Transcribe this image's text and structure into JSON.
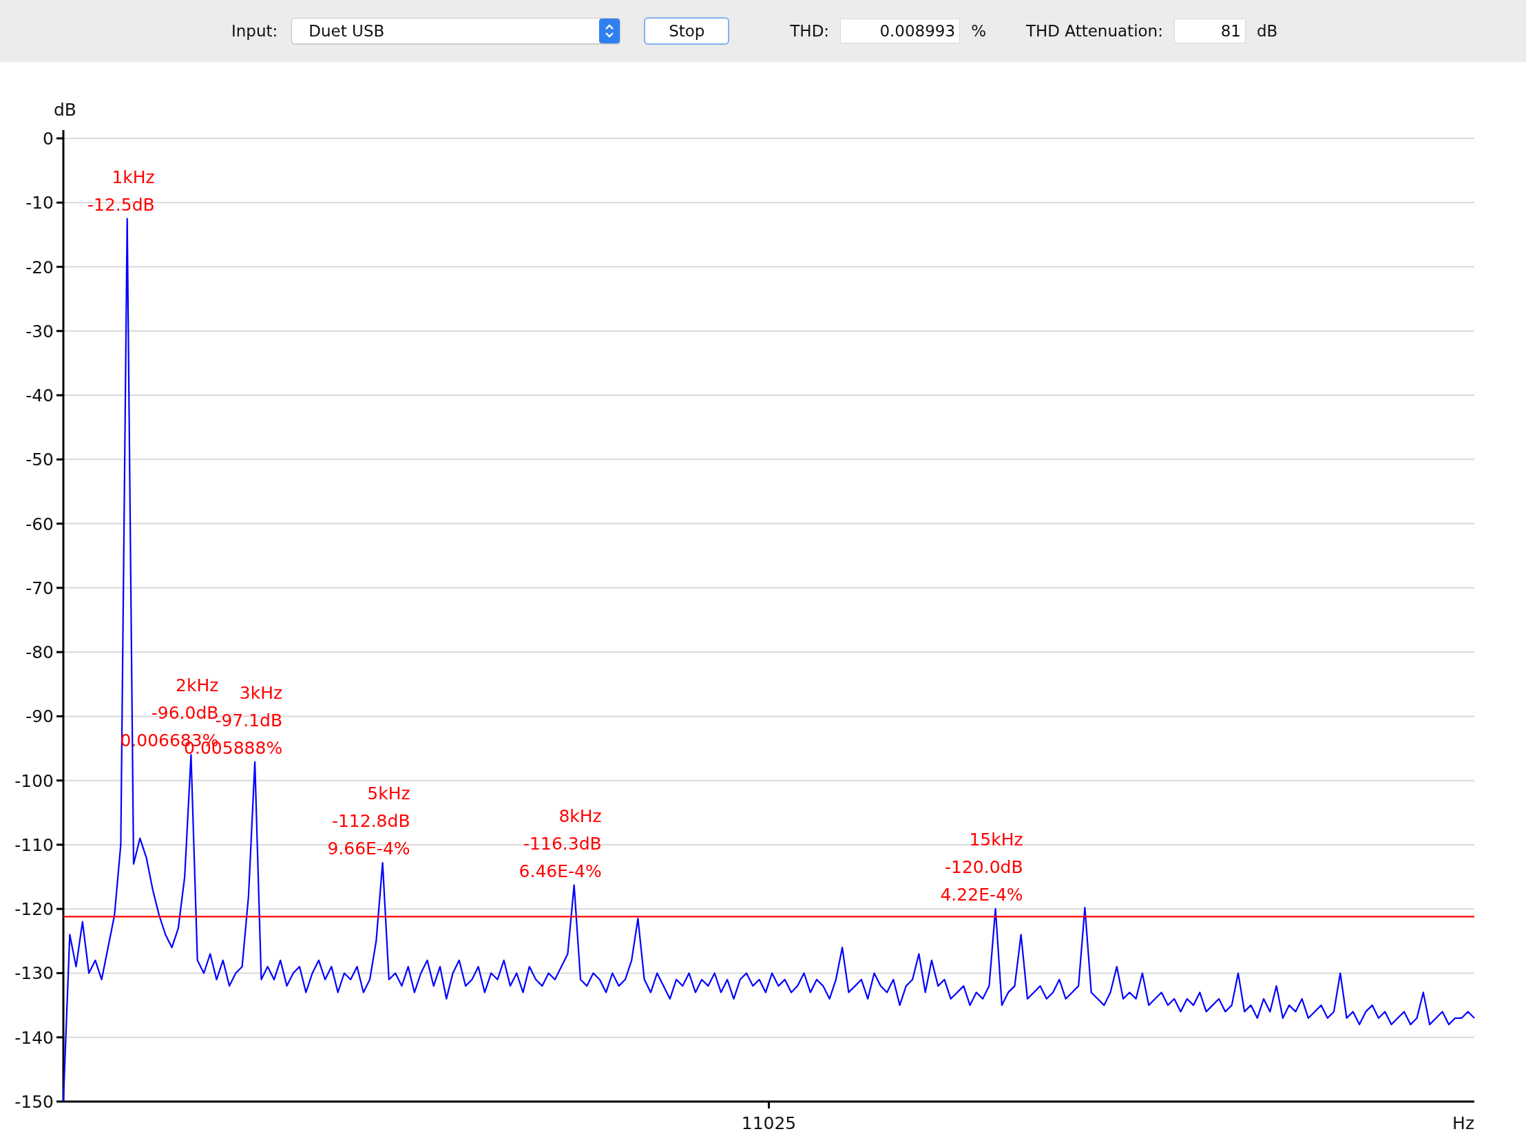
{
  "toolbar": {
    "input_label": "Input:",
    "input_dropdown": {
      "value": "Duet USB"
    },
    "stop_button": "Stop",
    "thd_label": "THD:",
    "thd_field": {
      "value": "0.008993"
    },
    "thd_unit": "%",
    "attenuation_label": "THD Attenuation:",
    "attenuation_field": {
      "value": "81"
    },
    "attenuation_unit": "dB"
  },
  "spectrum": {
    "chart_data": {
      "type": "line",
      "xlabel": "Hz",
      "ylabel": "dB",
      "ylim": [
        -150,
        0
      ],
      "grid": true,
      "yticks": [
        {
          "value": 0,
          "label": "0"
        },
        {
          "value": -10,
          "label": "-10"
        },
        {
          "value": -20,
          "label": "-20"
        },
        {
          "value": -30,
          "label": "-30"
        },
        {
          "value": -40,
          "label": "-40"
        },
        {
          "value": -50,
          "label": "-50"
        },
        {
          "value": -60,
          "label": "-60"
        },
        {
          "value": -70,
          "label": "-70"
        },
        {
          "value": -80,
          "label": "-80"
        },
        {
          "value": -90,
          "label": "-90"
        },
        {
          "value": -100,
          "label": "-100"
        },
        {
          "value": -110,
          "label": "-110"
        },
        {
          "value": -120,
          "label": "-120"
        },
        {
          "value": -130,
          "label": "-130"
        },
        {
          "value": -140,
          "label": "-140"
        },
        {
          "value": -150,
          "label": "-150"
        }
      ],
      "series": [
        {
          "color": "#0000ff",
          "values": [
            -150,
            -124,
            -129,
            -122,
            -130,
            -128,
            -131,
            -126,
            -121,
            -110,
            -12.5,
            -113,
            -109,
            -112,
            -117,
            -121,
            -124,
            -126,
            -123,
            -115,
            -96,
            -128,
            -130,
            -127,
            -131,
            -128,
            -132,
            -130,
            -129,
            -118,
            -97.1,
            -131,
            -129,
            -131,
            -128,
            -132,
            -130,
            -129,
            -133,
            -130,
            -128,
            -131,
            -129,
            -133,
            -130,
            -131,
            -129,
            -133,
            -131,
            -125,
            -112.8,
            -131,
            -130,
            -132,
            -129,
            -133,
            -130,
            -128,
            -132,
            -129,
            -134,
            -130,
            -128,
            -132,
            -131,
            -129,
            -133,
            -130,
            -131,
            -128,
            -132,
            -130,
            -133,
            -129,
            -131,
            -132,
            -130,
            -131,
            -129,
            -127,
            -116.3,
            -131,
            -132,
            -130,
            -131,
            -133,
            -130,
            -132,
            -131,
            -128,
            -121.5,
            -131,
            -133,
            -130,
            -132,
            -134,
            -131,
            -132,
            -130,
            -133,
            -131,
            -132,
            -130,
            -133,
            -131,
            -134,
            -131,
            -130,
            -132,
            -131,
            -133,
            -130,
            -132,
            -131,
            -133,
            -132,
            -130,
            -133,
            -131,
            -132,
            -134,
            -131,
            -126,
            -133,
            -132,
            -131,
            -134,
            -130,
            -132,
            -133,
            -131,
            -135,
            -132,
            -131,
            -127,
            -133,
            -128,
            -132,
            -131,
            -134,
            -133,
            -132,
            -135,
            -133,
            -134,
            -132,
            -120,
            -135,
            -133,
            -132,
            -124,
            -134,
            -133,
            -132,
            -134,
            -133,
            -131,
            -134,
            -133,
            -132,
            -119.8,
            -133,
            -134,
            -135,
            -133,
            -129,
            -134,
            -133,
            -134,
            -130,
            -135,
            -134,
            -133,
            -135,
            -134,
            -136,
            -134,
            -135,
            -133,
            -136,
            -135,
            -134,
            -136,
            -135,
            -130,
            -136,
            -135,
            -137,
            -134,
            -136,
            -132,
            -137,
            -135,
            -136,
            -134,
            -137,
            -136,
            -135,
            -137,
            -136,
            -130,
            -137,
            -136,
            -138,
            -136,
            -135,
            -137,
            -136,
            -138,
            -137,
            -136,
            -138,
            -137,
            -133,
            -138,
            -137,
            -136,
            -138,
            -137,
            -137,
            -136,
            -137
          ]
        }
      ],
      "ref_lines": [
        {
          "axis": "y",
          "value": -121.2
        }
      ],
      "annotations": [
        "1kHz\n-12.5dB",
        "2kHz\n-96.0dB\n0.006683%",
        "3kHz\n-97.1dB\n0.005888%",
        "5kHz\n-112.8dB\n9.66E-4%",
        "8kHz\n-116.3dB\n6.46E-4%",
        "15kHz\n-120.0dB\n4.22E-4%"
      ]
    },
    "x_axis_center_label": "11025"
  }
}
